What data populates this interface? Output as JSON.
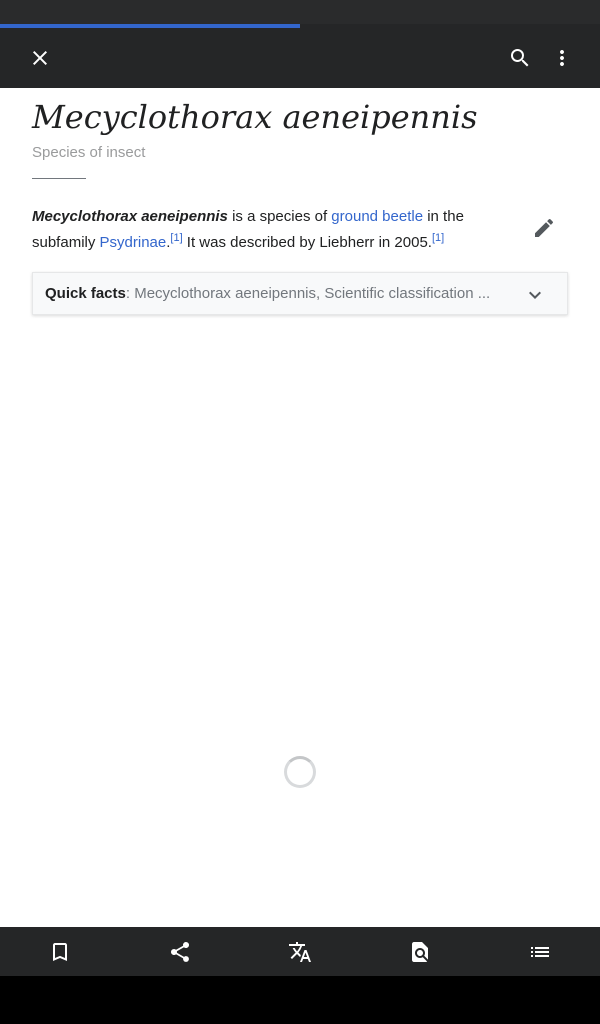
{
  "progress": {
    "fraction": 0.5
  },
  "toolbar": {
    "close_icon": "close-icon",
    "search_icon": "search-icon",
    "overflow_icon": "more-vert-icon"
  },
  "article": {
    "title": "Mecyclothorax aeneipennis",
    "description": "Species of insect",
    "lead": {
      "subject": "Mecyclothorax aeneipennis",
      "text1": " is a species of ",
      "link1": "ground beetle",
      "text2": " in the subfamily ",
      "link2": "Psydrinae",
      "text3": ".",
      "ref1": "[1]",
      "text4": " It was described by Liebherr in 2005.",
      "ref2": "[1]"
    },
    "edit_icon": "pencil-icon"
  },
  "quick_facts": {
    "label": "Quick facts",
    "separator": ": ",
    "summary": "Mecyclothorax aeneipennis, Scientific classification ..."
  },
  "bottom_bar": {
    "icons": [
      "bookmark-icon",
      "share-icon",
      "translate-icon",
      "find-in-page-icon",
      "contents-icon"
    ]
  },
  "colors": {
    "accent": "#3366cc",
    "toolbar_bg": "#252627",
    "text": "#202122",
    "muted": "#72777d"
  }
}
